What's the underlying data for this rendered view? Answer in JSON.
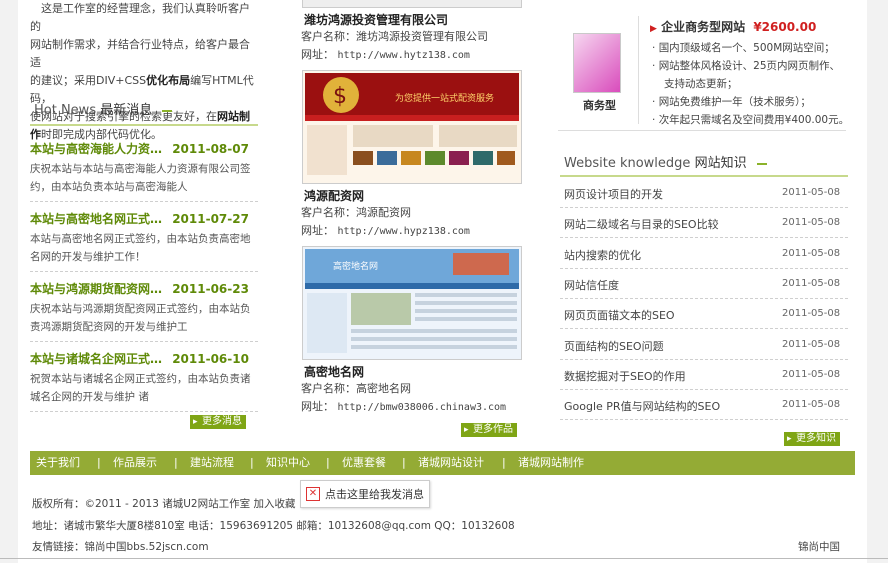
{
  "intro": {
    "line1": "这是工作室的经营理念，我们认真聆听客户的",
    "line2": "网站制作需求，并结合行业特点，给客户最合适",
    "line3a": "的建议；采用DIV+CSS",
    "line3b": "优化布局",
    "line3c": "编写HTML代码，",
    "line4a": "使网站对于搜索引擎的检索更友好，在",
    "line4b": "网站制",
    "line5a": "作",
    "line5b": "时即完成内部代码优化。"
  },
  "hot_news": {
    "title_en": "Hot News",
    "title_cn": "最新消息",
    "items": [
      {
        "title": "本站与高密海能人力资…",
        "date": "2011-08-07",
        "desc1": "庆祝本站与本站与高密海能人力资源有限公司签",
        "desc2": "约，由本站负责本站与高密海能人"
      },
      {
        "title": "本站与高密地名网正式…",
        "date": "2011-07-27",
        "desc1": "本站与高密地名网正式签约，由本站负责高密地",
        "desc2": "名网的开发与维护工作！"
      },
      {
        "title": "本站与鸿源期货配资网…",
        "date": "2011-06-23",
        "desc1": "庆祝本站与鸿源期货配资网正式签约，由本站负",
        "desc2": "责鸿源期货配资网的开发与维护工"
      },
      {
        "title": "本站与诸城名企网正式…",
        "date": "2011-06-10",
        "desc1": "祝贺本站与诸城名企网正式签约，由本站负责诸",
        "desc2": "城名企网的开发与维护        诸"
      }
    ],
    "more": "更多消息"
  },
  "cases": {
    "items": [
      {
        "name": "潍坊鸿源投资管理有限公司",
        "client_label": "客户名称：",
        "client": "潍坊鸿源投资管理有限公司",
        "url_label": "网址：",
        "url": "http://www.hytz138.com"
      },
      {
        "name": "鸿源配资网",
        "client_label": "客户名称：",
        "client": "鸿源配资网",
        "url_label": "网址：",
        "url": "http://www.hypz138.com",
        "thumb_text": "为您提供一站式配资服务"
      },
      {
        "name": "高密地名网",
        "client_label": "客户名称：",
        "client": "高密地名网",
        "url_label": "网址：",
        "url": "http://bmw038006.chinaw3.com",
        "thumb_text": "高密地名网"
      }
    ],
    "more": "更多作品"
  },
  "package": {
    "title": "企业商务型网站",
    "price": "¥2600.00",
    "label": "商务型",
    "features": [
      "国内顶级域名一个、500M网站空间；",
      "网站整体风格设计、25页内网页制作、",
      "支持动态更新；",
      "网站免费维护一年（技术服务）；",
      "次年起只需域名及空间费用¥400.00元。"
    ]
  },
  "knowledge": {
    "title_en": "Website knowledge",
    "title_cn": "网站知识",
    "items": [
      {
        "title": "网页设计项目的开发",
        "date": "2011-05-08"
      },
      {
        "title": "网站二级域名与目录的SEO比较",
        "date": "2011-05-08"
      },
      {
        "title": "站内搜索的优化",
        "date": "2011-05-08"
      },
      {
        "title": "网站信任度",
        "date": "2011-05-08"
      },
      {
        "title": "网页页面锚文本的SEO",
        "date": "2011-05-08"
      },
      {
        "title": "页面结构的SEO问题",
        "date": "2011-05-08"
      },
      {
        "title": "数据挖掘对于SEO的作用",
        "date": "2011-05-08"
      },
      {
        "title": "Google PR值与网站结构的SEO",
        "date": "2011-05-08"
      }
    ],
    "more": "更多知识"
  },
  "nav": {
    "items": [
      "关于我们",
      "作品展示",
      "建站流程",
      "知识中心",
      "优惠套餐",
      "诸城网站设计",
      "诸城网站制作"
    ],
    "separator": "|"
  },
  "footer": {
    "copyright": "版权所有：©2011 - 2013  诸城U2网站工作室  加入收藏",
    "address": "地址：诸城市繁华大厦8楼810室  电话：15963691205  邮箱：10132608@qq.com  QQ：10132608",
    "links_label": "友情链接：锦尚中国bbs.52jscn.com",
    "right_link": "锦尚中国"
  },
  "popup": {
    "text": "点击这里给我发消息"
  },
  "colors": {
    "accent_green": "#94ab35",
    "title_green": "#5f8a08",
    "price_red": "#d02020"
  }
}
